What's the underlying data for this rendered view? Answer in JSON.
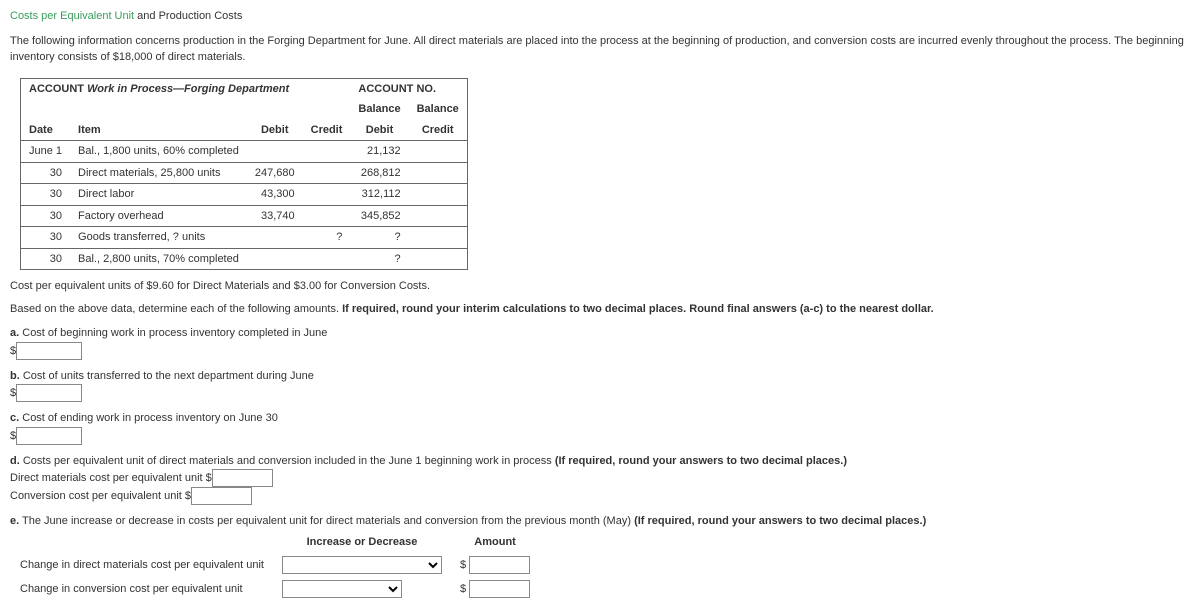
{
  "title_green": "Costs per Equivalent Unit",
  "title_rest": " and Production Costs",
  "intro": "The following information concerns production in the Forging Department for June. All direct materials are placed into the process at the beginning of production, and conversion costs are incurred evenly throughout the process. The beginning inventory consists of $18,000 of direct materials.",
  "account_header_left": "ACCOUNT ",
  "account_header_italic": "Work in Process—Forging Department",
  "account_no": "ACCOUNT NO.",
  "col_date": "Date",
  "col_item": "Item",
  "col_debit": "Debit",
  "col_credit": "Credit",
  "col_bal_debit_top": "Balance",
  "col_bal_credit_top": "Balance",
  "rows": [
    {
      "date": "June 1",
      "item": "Bal., 1,800 units, 60% completed",
      "debit": "",
      "credit": "",
      "bdebit": "21,132",
      "bcredit": ""
    },
    {
      "date": "30",
      "item": "Direct materials, 25,800 units",
      "debit": "247,680",
      "credit": "",
      "bdebit": "268,812",
      "bcredit": ""
    },
    {
      "date": "30",
      "item": "Direct labor",
      "debit": "43,300",
      "credit": "",
      "bdebit": "312,112",
      "bcredit": ""
    },
    {
      "date": "30",
      "item": "Factory overhead",
      "debit": "33,740",
      "credit": "",
      "bdebit": "345,852",
      "bcredit": ""
    },
    {
      "date": "30",
      "item": "Goods transferred, ? units",
      "debit": "",
      "credit": "?",
      "bdebit": "?",
      "bcredit": ""
    },
    {
      "date": "30",
      "item": "Bal., 2,800 units, 70% completed",
      "debit": "",
      "credit": "",
      "bdebit": "?",
      "bcredit": ""
    }
  ],
  "cost_note": "Cost per equivalent units of $9.60 for Direct Materials and $3.00 for Conversion Costs.",
  "based_on": "Based on the above data, determine each of the following amounts. ",
  "based_on_bold": "If required, round your interim calculations to two decimal places. Round final answers (a-c) to the nearest dollar.",
  "qa_label": "a.",
  "qa_text": "Cost of beginning work in process inventory completed in June",
  "qb_label": "b.",
  "qb_text": "Cost of units transferred to the next department during June",
  "qc_label": "c.",
  "qc_text": "Cost of ending work in process inventory on June 30",
  "qd_label": "d.",
  "qd_text": "Costs per equivalent unit of direct materials and conversion included in the June 1 beginning work in process ",
  "qd_bold": "(If required, round your answers to two decimal places.)",
  "qd_line1": "Direct materials cost per equivalent unit $",
  "qd_line2": "Conversion cost per equivalent unit $",
  "qe_label": "e.",
  "qe_text": "The June increase or decrease in costs per equivalent unit for direct materials and conversion from the previous month (May) ",
  "qe_bold": "(If required, round your answers to two decimal places.)",
  "etable_h1": "Increase or Decrease",
  "etable_h2": "Amount",
  "erow1": "Change in direct materials cost per equivalent unit",
  "erow2": "Change in conversion cost per equivalent unit",
  "dollar": "$"
}
